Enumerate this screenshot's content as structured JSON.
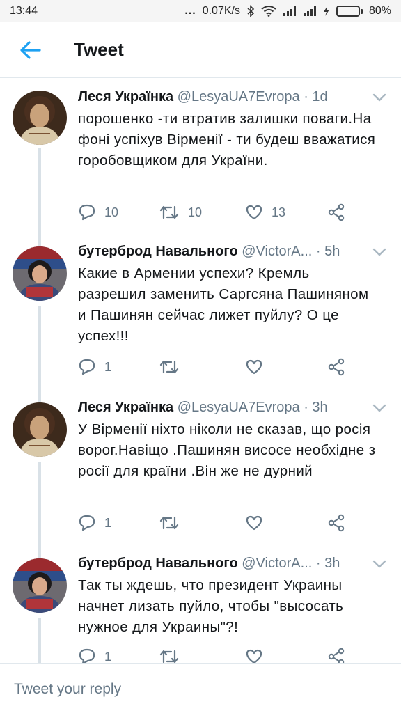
{
  "status_bar": {
    "time": "13:44",
    "dots": "...",
    "net_speed": "0.07K/s",
    "battery": "80%",
    "battery_level": 0.8
  },
  "header": {
    "title": "Tweet",
    "back_icon": "arrow-left-icon",
    "accent": "#1da1f2"
  },
  "tweets": [
    {
      "name": "Леся Українка",
      "handle": "@LesyaUA7Evropa",
      "sep": "·",
      "time": "1d",
      "text": "порошенко -ти втратив залишки поваги.На фоні успіхув Вірменії - ти будеш вважатися горобовщиком для України.",
      "replies": "10",
      "retweets": "10",
      "likes": "13"
    },
    {
      "name": "бутерброд Навального",
      "handle": "@VictorA...",
      "sep": "·",
      "time": "5h",
      "text": "Какие в Армении успехи? Кремль разрешил заменить Саргсяна Пашиняном и Пашинян сейчас лижет пуйлу? О це успех!!!",
      "replies": "1",
      "retweets": "",
      "likes": ""
    },
    {
      "name": "Леся Українка",
      "handle": "@LesyaUA7Evropa",
      "sep": "·",
      "time": "3h",
      "text": "У Вірменії ніхто ніколи не сказав, що росія ворог.Навіщо .Пашинян висосе необхідне з росії для країни .Він же не дурний",
      "replies": "1",
      "retweets": "",
      "likes": ""
    },
    {
      "name": "бутерброд Навального",
      "handle": "@VictorA...",
      "sep": "·",
      "time": "3h",
      "text": "Так ты ждешь, что президент Украины начнет лизать пуйло, чтобы \"высосать нужное для Украины\"?!",
      "replies": "1",
      "retweets": "",
      "likes": ""
    }
  ],
  "reply": {
    "placeholder": "Tweet your reply"
  }
}
